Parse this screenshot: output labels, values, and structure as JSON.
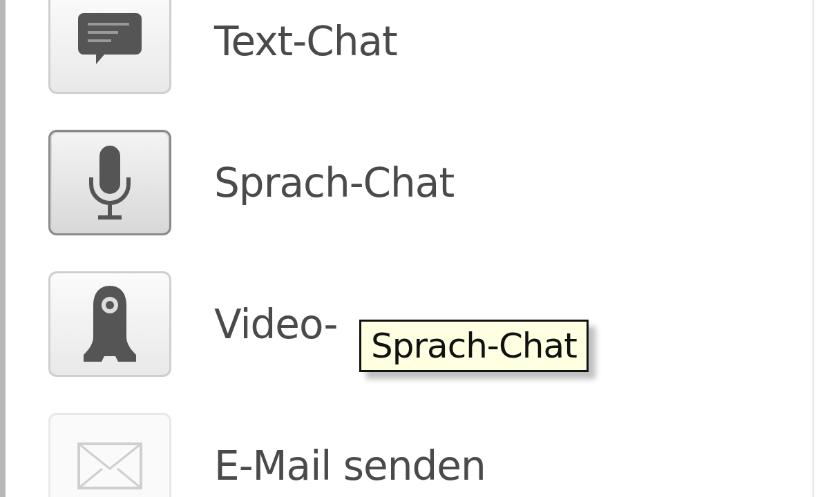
{
  "menu": {
    "items": [
      {
        "kind": "chat",
        "label": "Text-Chat",
        "hovered": false,
        "disabled": false
      },
      {
        "kind": "mic",
        "label": "Sprach-Chat",
        "hovered": true,
        "disabled": false
      },
      {
        "kind": "webcam",
        "label": "Video-",
        "hovered": false,
        "disabled": false
      },
      {
        "kind": "mail",
        "label": "E-Mail senden",
        "hovered": false,
        "disabled": true
      }
    ]
  },
  "tooltip": {
    "text": "Sprach-Chat"
  }
}
